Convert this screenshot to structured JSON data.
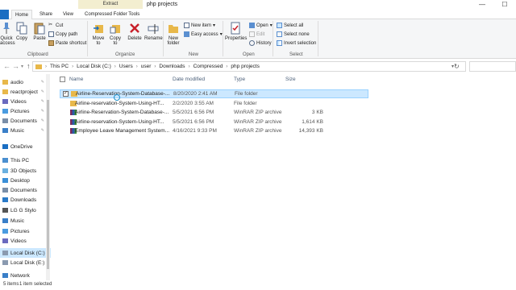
{
  "titlebar": {
    "context_tab": "Extract",
    "title": "php projects",
    "min": "—",
    "max": "☐"
  },
  "tabs": {
    "home": "Home",
    "share": "Share",
    "view": "View",
    "compressed": "Compressed Folder Tools"
  },
  "ribbon": {
    "clipboard": {
      "label": "Clipboard",
      "quick_access": "Quick\naccess",
      "copy": "Copy",
      "paste": "Paste",
      "cut": "Cut",
      "copy_path": "Copy path",
      "paste_shortcut": "Paste shortcut"
    },
    "organize": {
      "label": "Organize",
      "move_to": "Move\nto",
      "copy_to": "Copy\nto",
      "delete": "Delete",
      "rename": "Rename"
    },
    "new": {
      "label": "New",
      "new_folder": "New\nfolder",
      "new_item": "New item",
      "easy_access": "Easy access"
    },
    "open": {
      "label": "Open",
      "properties": "Properties",
      "open": "Open",
      "edit": "Edit",
      "history": "History"
    },
    "select": {
      "label": "Select",
      "select_all": "Select all",
      "select_none": "Select none",
      "invert": "Invert selection"
    }
  },
  "address": {
    "crumbs": [
      "This PC",
      "Local Disk (C:)",
      "Users",
      "user",
      "Downloads",
      "Compressed",
      "php projects"
    ]
  },
  "nav": {
    "items": [
      {
        "label": "audio",
        "pinned": true,
        "selected": false,
        "icon": "folder-icon"
      },
      {
        "label": "reactproject",
        "pinned": true,
        "selected": false,
        "icon": "folder-icon"
      },
      {
        "label": "Videos",
        "pinned": true,
        "selected": false,
        "icon": "videos-icon"
      },
      {
        "label": "Pictures",
        "pinned": true,
        "selected": false,
        "icon": "pictures-icon"
      },
      {
        "label": "Documents",
        "pinned": true,
        "selected": false,
        "icon": "documents-icon"
      },
      {
        "label": "Music",
        "pinned": true,
        "selected": false,
        "icon": "music-icon"
      },
      {
        "label": "OneDrive",
        "pinned": false,
        "selected": false,
        "icon": "onedrive-icon"
      },
      {
        "label": "This PC",
        "pinned": false,
        "selected": false,
        "icon": "pc-icon"
      },
      {
        "label": "3D Objects",
        "pinned": false,
        "selected": false,
        "icon": "3d-objects-icon"
      },
      {
        "label": "Desktop",
        "pinned": false,
        "selected": false,
        "icon": "desktop-icon"
      },
      {
        "label": "Documents",
        "pinned": false,
        "selected": false,
        "icon": "documents-icon"
      },
      {
        "label": "Downloads",
        "pinned": false,
        "selected": false,
        "icon": "downloads-icon"
      },
      {
        "label": "LG G Stylo",
        "pinned": false,
        "selected": false,
        "icon": "phone-icon"
      },
      {
        "label": "Music",
        "pinned": false,
        "selected": false,
        "icon": "music-icon"
      },
      {
        "label": "Pictures",
        "pinned": false,
        "selected": false,
        "icon": "pictures-icon"
      },
      {
        "label": "Videos",
        "pinned": false,
        "selected": false,
        "icon": "videos-icon"
      },
      {
        "label": "Local Disk (C:)",
        "pinned": false,
        "selected": true,
        "icon": "drive-icon"
      },
      {
        "label": "Local Disk (E:)",
        "pinned": false,
        "selected": false,
        "icon": "drive-icon"
      },
      {
        "label": "Network",
        "pinned": false,
        "selected": false,
        "icon": "network-icon"
      }
    ]
  },
  "columns": {
    "name": "Name",
    "date": "Date modified",
    "type": "Type",
    "size": "Size"
  },
  "files": [
    {
      "name": "Airline-Reservation-System-Database-...",
      "date": "8/20/2020 2:41 AM",
      "type": "File folder",
      "size": "",
      "kind": "folder",
      "selected": true
    },
    {
      "name": "Airline-reservation-System-Using-HT...",
      "date": "2/2/2020 3:55 AM",
      "type": "File folder",
      "size": "",
      "kind": "folder",
      "selected": false
    },
    {
      "name": "Airline-Reservation-System-Database-...",
      "date": "5/5/2021 6:56 PM",
      "type": "WinRAR ZIP archive",
      "size": "3 KB",
      "kind": "zip",
      "selected": false
    },
    {
      "name": "Airline-reservation-System-Using-HT...",
      "date": "5/5/2021 6:56 PM",
      "type": "WinRAR ZIP archive",
      "size": "1,614 KB",
      "kind": "zip",
      "selected": false
    },
    {
      "name": "Employee Leave Management System...",
      "date": "4/16/2021 9:33 PM",
      "type": "WinRAR ZIP archive",
      "size": "14,393 KB",
      "kind": "zip",
      "selected": false
    }
  ],
  "status": {
    "count": "5 items",
    "selected": "1 item selected"
  },
  "colors": {
    "accent": "#1a6ec2",
    "selection": "#cce8ff",
    "folder": "#e8b84a"
  }
}
